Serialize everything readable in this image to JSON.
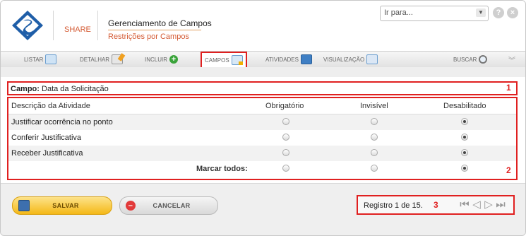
{
  "header": {
    "brand": "SHARE",
    "title": "Gerenciamento de Campos",
    "subtitle": "Restrições por Campos",
    "goto_value": "Ir para...",
    "help_icon": "?",
    "close_icon": "×"
  },
  "toolbar": {
    "items": [
      {
        "label": "LISTAR",
        "icon": "list-grid-icon"
      },
      {
        "label": "DETALHAR",
        "icon": "edit-icon"
      },
      {
        "label": "INCLUIR",
        "icon": "add-icon"
      },
      {
        "label": "CAMPOS",
        "icon": "fields-icon"
      },
      {
        "label": "ATIVIDADES",
        "icon": "activities-icon"
      },
      {
        "label": "VISUALIZAÇÃO",
        "icon": "view-icon"
      },
      {
        "label": "BUSCAR",
        "icon": "search-icon"
      }
    ]
  },
  "field": {
    "label": "Campo:",
    "value": "Data da Solicitação"
  },
  "table": {
    "columns": [
      "Descrição da Atividade",
      "Obrigatório",
      "Invisível",
      "Desabilitado"
    ],
    "rows": [
      {
        "activity": "Justificar ocorrência no ponto",
        "selected": "Desabilitado"
      },
      {
        "activity": "Conferir Justificativa",
        "selected": "Desabilitado"
      },
      {
        "activity": "Receber Justificativa",
        "selected": "Desabilitado"
      }
    ],
    "mark_all_label": "Marcar todos:",
    "mark_all_selected": "Desabilitado"
  },
  "annotations": [
    "1",
    "2",
    "3"
  ],
  "footer": {
    "save_label": "SALVAR",
    "cancel_label": "CANCELAR",
    "record_text": "Registro 1 de 15."
  },
  "colors": {
    "accent": "#d45b34",
    "highlight": "#e02020",
    "save_button": "#f4b817"
  }
}
